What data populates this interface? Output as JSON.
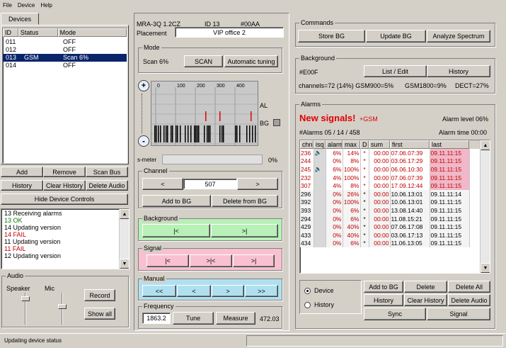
{
  "menu": {
    "file": "File",
    "device": "Device",
    "help": "Help"
  },
  "devices_tab": "Devices",
  "device_list": {
    "headers": [
      "ID",
      "Status",
      "Mode"
    ],
    "rows": [
      {
        "id": "011",
        "status": "",
        "mode": "OFF"
      },
      {
        "id": "012",
        "status": "",
        "mode": "OFF"
      },
      {
        "id": "013",
        "status": "GSM",
        "mode": "Scan 6%"
      },
      {
        "id": "014",
        "status": "",
        "mode": "OFF"
      }
    ]
  },
  "device_buttons": {
    "add": "Add",
    "remove": "Remove",
    "scan_bus": "Scan Bus",
    "history": "History",
    "clear_history": "Clear History",
    "delete_audio": "Delete Audio",
    "hide_controls": "Hide Device Controls"
  },
  "log": [
    {
      "text": "13 Receiving alarms",
      "color": "#000000"
    },
    {
      "text": "13 OK",
      "color": "#008000"
    },
    {
      "text": "14 Updating version",
      "color": "#000000"
    },
    {
      "text": "14 FAIL",
      "color": "#c00000"
    },
    {
      "text": "11 Updating version",
      "color": "#000000"
    },
    {
      "text": "11 FAIL",
      "color": "#c00000"
    },
    {
      "text": "12 Updating version",
      "color": "#000000"
    }
  ],
  "audio": {
    "title": "Audio",
    "speaker": "Speaker",
    "mic": "Mic",
    "record": "Record",
    "show_all": "Show all"
  },
  "status_bar": "Updating device status",
  "device_info": {
    "model": "MRA-3Q 1.2CZ",
    "id": "ID 13",
    "code": "#00AA",
    "placement_label": "Placement",
    "placement_value": "VIP office 2"
  },
  "mode": {
    "title": "Mode",
    "value": "Scan 6%",
    "scan": "SCAN",
    "auto": "Automatic tuning"
  },
  "spectrum": {
    "ticks": [
      "0",
      "100",
      "200",
      "300",
      "400"
    ],
    "al_label": "AL",
    "bg_label": "BG",
    "zoom_in": "+",
    "zoom_out": "-"
  },
  "smeter": {
    "label": "s-meter",
    "value": "0%"
  },
  "channel": {
    "title": "Channel",
    "value": "507",
    "prev": "<",
    "next": ">",
    "add_bg": "Add to BG",
    "del_bg": "Delete from BG"
  },
  "background_nav": {
    "title": "Background",
    "first": "|<",
    "last": ">|"
  },
  "signal_nav": {
    "title": "Signal",
    "first": "|<",
    "mid": ">|<",
    "last": ">|"
  },
  "manual_nav": {
    "title": "Manual",
    "b1": "<<",
    "b2": "<",
    "b3": ">",
    "b4": ">>"
  },
  "frequency": {
    "title": "Frequency",
    "value": "1863.2",
    "tune": "Tune",
    "measure": "Measure",
    "reading": "472.03"
  },
  "commands": {
    "title": "Commands",
    "store": "Store BG",
    "update": "Update BG",
    "analyze": "Analyze Spectrum"
  },
  "background": {
    "title": "Background",
    "code": "#E00F",
    "list_edit": "List / Edit",
    "history": "History",
    "channels": "channels=72 (14%) GSM900=5%",
    "gsm1800": "GSM1800=9%",
    "dect": "DECT=27%"
  },
  "alarms": {
    "title": "Alarms",
    "new_signals": "New signals!",
    "new_type": "+GSM",
    "level": "Alarm level 06%",
    "count": "#Alarms 05 / 14 / 458",
    "time": "Alarm time 00:00",
    "headers": [
      "chn",
      "isq",
      "alarm",
      "max",
      "D",
      "sum",
      "first",
      "last"
    ],
    "rows": [
      [
        "236",
        "s",
        "6%",
        "14%",
        "*",
        "00:00",
        "07.06.07:39",
        "09.11.11:15"
      ],
      [
        "244",
        "",
        "0%",
        "8%",
        "*",
        "00:00",
        "03.06.17:29",
        "09.11.11:15"
      ],
      [
        "245",
        "s",
        "6%",
        "100%",
        "*",
        "00:00",
        "06.06.10:30",
        "09.11.11:15"
      ],
      [
        "232",
        "",
        "4%",
        "100%",
        "*",
        "00:00",
        "07.06.07:39",
        "09.11.11:15"
      ],
      [
        "307",
        "",
        "4%",
        "8%",
        "*",
        "00:00",
        "17.09.12:44",
        "09.11.11:15"
      ],
      [
        "296",
        "",
        "0%",
        "26%",
        "*",
        "00:00",
        "10.06.13:01",
        "09.11.11:14"
      ],
      [
        "392",
        "",
        "0%",
        "100%",
        "*",
        "00:00",
        "10.06.13:01",
        "09.11.11:15"
      ],
      [
        "393",
        "",
        "0%",
        "6%",
        "*",
        "00:00",
        "13.08.14:40",
        "09.11.11:15"
      ],
      [
        "294",
        "",
        "0%",
        "6%",
        "*",
        "00:00",
        "11.08.15:21",
        "09.11.11:15"
      ],
      [
        "429",
        "",
        "0%",
        "40%",
        "*",
        "00:00",
        "07.06.17:08",
        "09.11.11:15"
      ],
      [
        "433",
        "",
        "0%",
        "40%",
        "*",
        "00:00",
        "03.06.17:13",
        "09.11.11:15"
      ],
      [
        "434",
        "",
        "0%",
        "6%",
        "*",
        "00:00",
        "11.06.13:05",
        "09.11.11:15"
      ]
    ]
  },
  "bottom_right": {
    "device": "Device",
    "history": "History",
    "add_bg": "Add to BG",
    "delete": "Delete",
    "delete_all": "Delete All",
    "history_btn": "History",
    "clear_history": "Clear History",
    "delete_audio": "Delete Audio",
    "sync": "Sync",
    "signal": "Signal"
  }
}
